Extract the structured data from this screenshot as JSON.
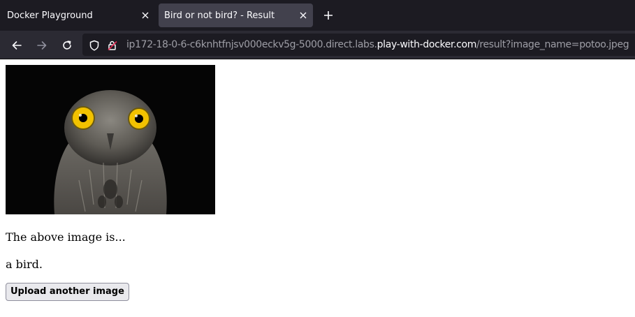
{
  "tabs": [
    {
      "title": "Docker Playground",
      "active": false
    },
    {
      "title": "Bird or not bird? - Result",
      "active": true
    }
  ],
  "icons": {
    "tab_close": "close-icon",
    "new_tab": "plus-icon",
    "back": "back-arrow-icon",
    "forward": "forward-arrow-icon",
    "reload": "reload-icon",
    "tracking_protection": "shield-icon",
    "site_security": "insecure-lock-icon"
  },
  "url": {
    "prefix": "ip172-18-0-6-c6knhtfnjsv000eckv5g-5000.direct.labs.",
    "domain": "play-with-docker.com",
    "path": "/result?image_name=potoo.jpeg"
  },
  "page": {
    "image_subject": "potoo bird",
    "intro_text": "The above image is...",
    "result_text": "a bird.",
    "upload_button_label": "Upload another image"
  },
  "colors": {
    "tab_strip": "#1c1b22",
    "active_tab": "#42414d",
    "toolbar": "#2b2a33",
    "urlbar": "#1c1b22",
    "bird_eye": "#f2c200"
  }
}
